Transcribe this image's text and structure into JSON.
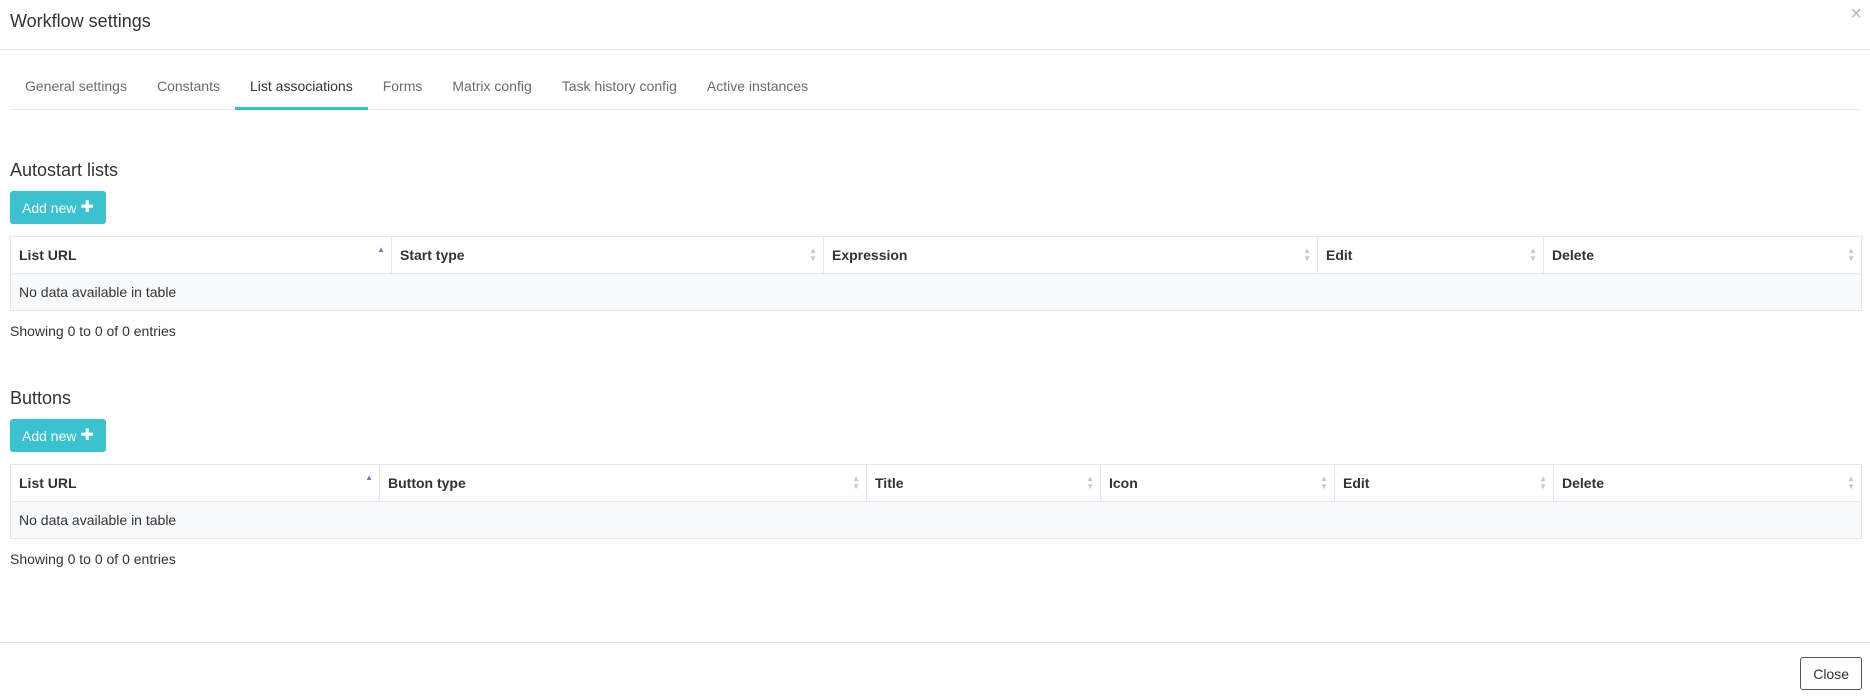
{
  "modal": {
    "title": "Workflow settings",
    "close_x": "×",
    "close_button": "Close"
  },
  "tabs": [
    {
      "label": "General settings",
      "active": false
    },
    {
      "label": "Constants",
      "active": false
    },
    {
      "label": "List associations",
      "active": true
    },
    {
      "label": "Forms",
      "active": false
    },
    {
      "label": "Matrix config",
      "active": false
    },
    {
      "label": "Task history config",
      "active": false
    },
    {
      "label": "Active instances",
      "active": false
    }
  ],
  "autostart": {
    "title": "Autostart lists",
    "add_label": "Add new",
    "columns": [
      "List URL",
      "Start type",
      "Expression",
      "Edit",
      "Delete"
    ],
    "empty_text": "No data available in table",
    "info": "Showing 0 to 0 of 0 entries"
  },
  "buttons": {
    "title": "Buttons",
    "add_label": "Add new",
    "columns": [
      "List URL",
      "Button type",
      "Title",
      "Icon",
      "Edit",
      "Delete"
    ],
    "empty_text": "No data available in table",
    "info": "Showing 0 to 0 of 0 entries"
  },
  "colors": {
    "accent": "#3ac2d0",
    "tab_underline": "#2fc1cf",
    "sort_active": "#6b7cc4"
  }
}
